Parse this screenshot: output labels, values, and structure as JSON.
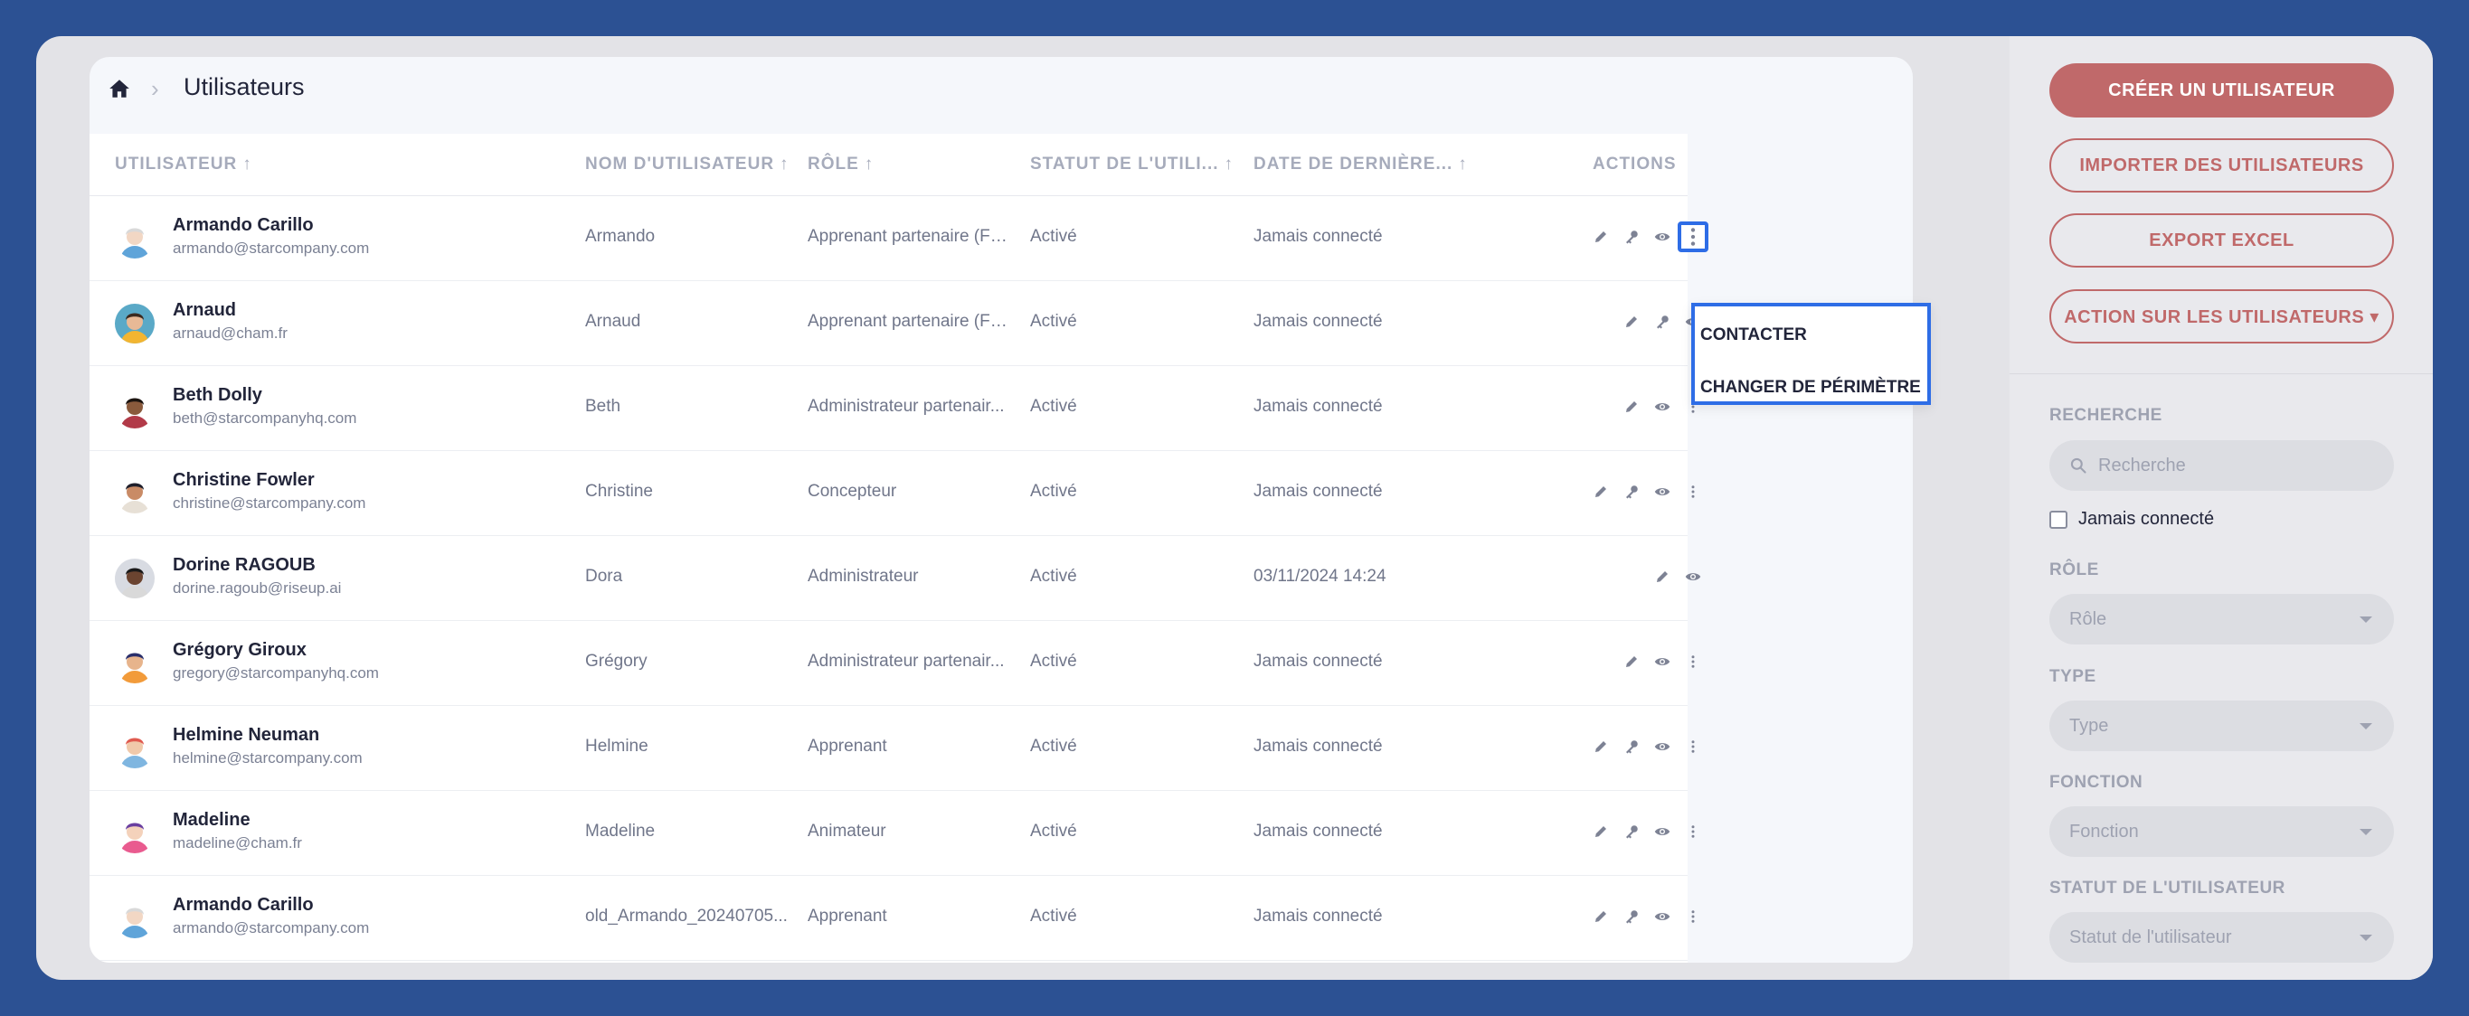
{
  "breadcrumb": {
    "title": "Utilisateurs"
  },
  "table": {
    "headers": {
      "user": "UTILISATEUR",
      "username": "NOM D'UTILISATEUR",
      "role": "RÔLE",
      "status": "STATUT DE L'UTILI...",
      "last_date": "DATE DE DERNIÈRE...",
      "actions": "ACTIONS"
    },
    "sort_arrow": "↑",
    "rows": [
      {
        "name": "Armando Carillo",
        "email": "armando@starcompany.com",
        "username": "Armando",
        "role": "Apprenant partenaire (FF...",
        "status": "Activé",
        "date": "Jamais connecté",
        "actions": [
          "edit",
          "key",
          "view",
          "more"
        ]
      },
      {
        "name": "Arnaud",
        "email": "arnaud@cham.fr",
        "username": "Arnaud",
        "role": "Apprenant partenaire (FF...",
        "status": "Activé",
        "date": "Jamais connecté",
        "actions": [
          "edit",
          "key",
          "view"
        ]
      },
      {
        "name": "Beth Dolly",
        "email": "beth@starcompanyhq.com",
        "username": "Beth",
        "role": "Administrateur partenair...",
        "status": "Activé",
        "date": "Jamais connecté",
        "actions": [
          "edit",
          "view",
          "more"
        ]
      },
      {
        "name": "Christine Fowler",
        "email": "christine@starcompany.com",
        "username": "Christine",
        "role": "Concepteur",
        "status": "Activé",
        "date": "Jamais connecté",
        "actions": [
          "edit",
          "key",
          "view",
          "more"
        ]
      },
      {
        "name": "Dorine RAGOUB",
        "email": "dorine.ragoub@riseup.ai",
        "username": "Dora",
        "role": "Administrateur",
        "status": "Activé",
        "date": "03/11/2024 14:24",
        "actions": [
          "edit",
          "view"
        ]
      },
      {
        "name": "Grégory Giroux",
        "email": "gregory@starcompanyhq.com",
        "username": "Grégory",
        "role": "Administrateur partenair...",
        "status": "Activé",
        "date": "Jamais connecté",
        "actions": [
          "edit",
          "view",
          "more"
        ]
      },
      {
        "name": "Helmine Neuman",
        "email": "helmine@starcompany.com",
        "username": "Helmine",
        "role": "Apprenant",
        "status": "Activé",
        "date": "Jamais connecté",
        "actions": [
          "edit",
          "key",
          "view",
          "more"
        ]
      },
      {
        "name": "Madeline",
        "email": "madeline@cham.fr",
        "username": "Madeline",
        "role": "Animateur",
        "status": "Activé",
        "date": "Jamais connecté",
        "actions": [
          "edit",
          "key",
          "view",
          "more"
        ]
      },
      {
        "name": "Armando Carillo",
        "email": "armando@starcompany.com",
        "username": "old_Armando_20240705...",
        "role": "Apprenant",
        "status": "Activé",
        "date": "Jamais connecté",
        "actions": [
          "edit",
          "key",
          "view",
          "more"
        ]
      }
    ]
  },
  "dropdown": {
    "items": [
      "CONTACTER",
      "CHANGER DE PÉRIMÈTRE"
    ]
  },
  "sidebar": {
    "create_label": "CRÉER UN UTILISATEUR",
    "import_label": "IMPORTER DES UTILISATEURS",
    "export_label": "EXPORT EXCEL",
    "action_label": "ACTION SUR LES UTILISATEURS ▾",
    "search_label": "RECHERCHE",
    "search_placeholder": "Recherche",
    "never_connected_label": "Jamais connecté",
    "role_label": "RÔLE",
    "role_value": "Rôle",
    "type_label": "TYPE",
    "type_value": "Type",
    "function_label": "FONCTION",
    "function_value": "Fonction",
    "status_label": "STATUT DE L'UTILISATEUR",
    "status_value": "Statut de l'utilisateur"
  },
  "colors": {
    "accent": "#c0696a",
    "highlight": "#2e6de6",
    "background": "#2c5193"
  }
}
